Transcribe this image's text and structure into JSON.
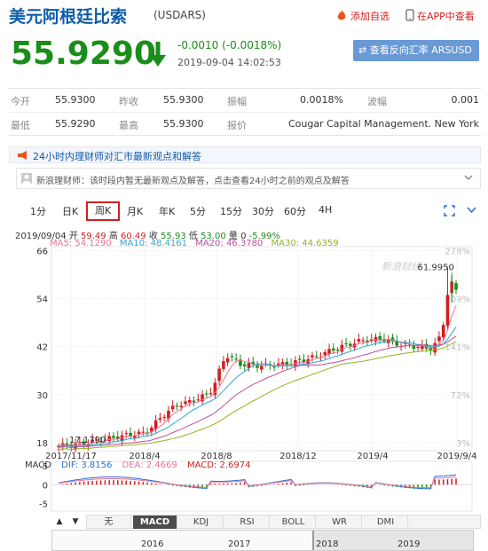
{
  "header": {
    "title": "美元阿根廷比索",
    "symbol": "(USDARS)",
    "add_fav": "添加自选",
    "app_link": "在APP中查看"
  },
  "quote": {
    "price": "55.9290",
    "change": "-0.0010 (-0.0018%)",
    "timestamp": "2019-09-04 14:02:53",
    "reverse_button": "查看反向汇率 ARSUSD",
    "price_color": "#1a8d1a"
  },
  "stats": {
    "row1": [
      {
        "label": "今开",
        "value": "55.9300"
      },
      {
        "label": "昨收",
        "value": "55.9300"
      },
      {
        "label": "振幅",
        "value": "0.0018%"
      },
      {
        "label": "波幅",
        "value": "0.001"
      }
    ],
    "row2": [
      {
        "label": "最低",
        "value": "55.9290"
      },
      {
        "label": "最高",
        "value": "55.9300"
      },
      {
        "label": "报价",
        "value": "Cougar Capital Management. New York"
      }
    ]
  },
  "promo": {
    "text": "24小时内理财师对汇市最新观点和解答"
  },
  "notice": {
    "text": "新浪理财师：该时段内暂无最新观点及解答，点击查看24小时之前的观点及解答"
  },
  "tabs": [
    "1分",
    "日K",
    "周K",
    "月K",
    "年K",
    "5分",
    "15分",
    "30分",
    "60分",
    "4H"
  ],
  "active_tab": "周K",
  "ohlc": {
    "date": "2019/09/04",
    "open_label": "开",
    "open": "59.49",
    "high_label": "高",
    "high": "60.49",
    "close_label": "收",
    "close": "55.93",
    "low_label": "低",
    "low": "53.00",
    "vol_label": "量",
    "vol": "0",
    "pct": "-5.99%"
  },
  "ma": [
    {
      "label": "MA5: 54.1290",
      "color": "#e8739a"
    },
    {
      "label": "MA10: 48.4161",
      "color": "#2aaad6"
    },
    {
      "label": "MA20: 46.3780",
      "color": "#c04f9e"
    },
    {
      "label": "MA30: 44.6359",
      "color": "#94b41e"
    }
  ],
  "chart_data": {
    "type": "candlestick",
    "y_ticks": [
      "66",
      "54",
      "42",
      "30",
      "18"
    ],
    "y_ticks_values": [
      66,
      54,
      42,
      30,
      18
    ],
    "ylim": [
      16,
      67
    ],
    "pct_ticks": [
      "278%",
      "209%",
      "141%",
      "72%",
      "3%"
    ],
    "x_ticks": [
      "2017/11/17",
      "2018/4",
      "2018/8",
      "2018/12",
      "2019/4",
      "2019/9/4"
    ],
    "max_label": "61.9950",
    "min_label": "17.1790",
    "watermark": "新浪财经",
    "colors": {
      "up": "#d21f1f",
      "down": "#1a8d1a"
    }
  },
  "macd": {
    "title": "MACD",
    "dif": "DIF: 3.8156",
    "dea": "DEA: 2.4669",
    "macd": "MACD: 2.6974",
    "y_ticks": [
      "5",
      "0",
      "-5"
    ],
    "dif_color": "#2a6fd6",
    "dea_color": "#e8739a",
    "macd_color": "#d21f1f"
  },
  "indicators": [
    "无",
    "MACD",
    "KDJ",
    "RSI",
    "BOLL",
    "WR",
    "DMI"
  ],
  "active_indicator": "MACD",
  "range": {
    "years": [
      "2016",
      "2017",
      "2018",
      "2019"
    ]
  }
}
